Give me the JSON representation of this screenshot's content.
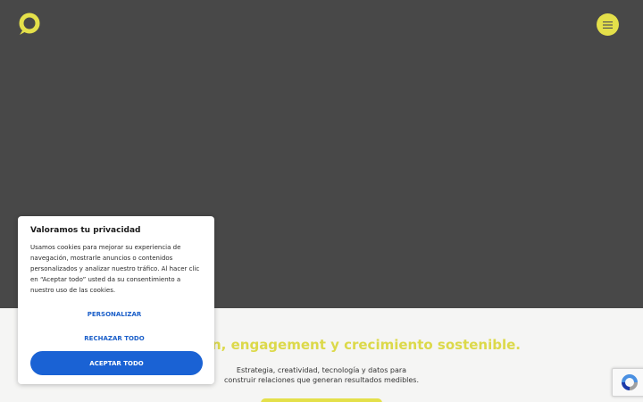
{
  "hero": {
    "menu_icon": "hamburger-menu-icon",
    "logo_icon": "brand-logo-icon"
  },
  "colors": {
    "accent": "#e4e04a",
    "hero_bg": "#484848",
    "primary_button": "#1a62d4",
    "link": "#1b5fc9"
  },
  "section": {
    "headline": "n, engagement y crecimiento sostenible.",
    "subtext": "Estrategia, creatividad, tecnología y datos para construir relaciones que generan resultados medibles."
  },
  "cookie_banner": {
    "title": "Valoramos tu privacidad",
    "body": "Usamos cookies para mejorar su experiencia de navegación, mostrarle anuncios o contenidos personalizados y analizar nuestro tráfico. Al hacer clic en “Aceptar todo” usted da su consentimiento a nuestro uso de las cookies.",
    "customize_label": "PERSONALIZAR",
    "reject_label": "RECHAZAR TODO",
    "accept_label": "ACEPTAR TODO"
  },
  "recaptcha": {
    "icon": "recaptcha-icon"
  }
}
